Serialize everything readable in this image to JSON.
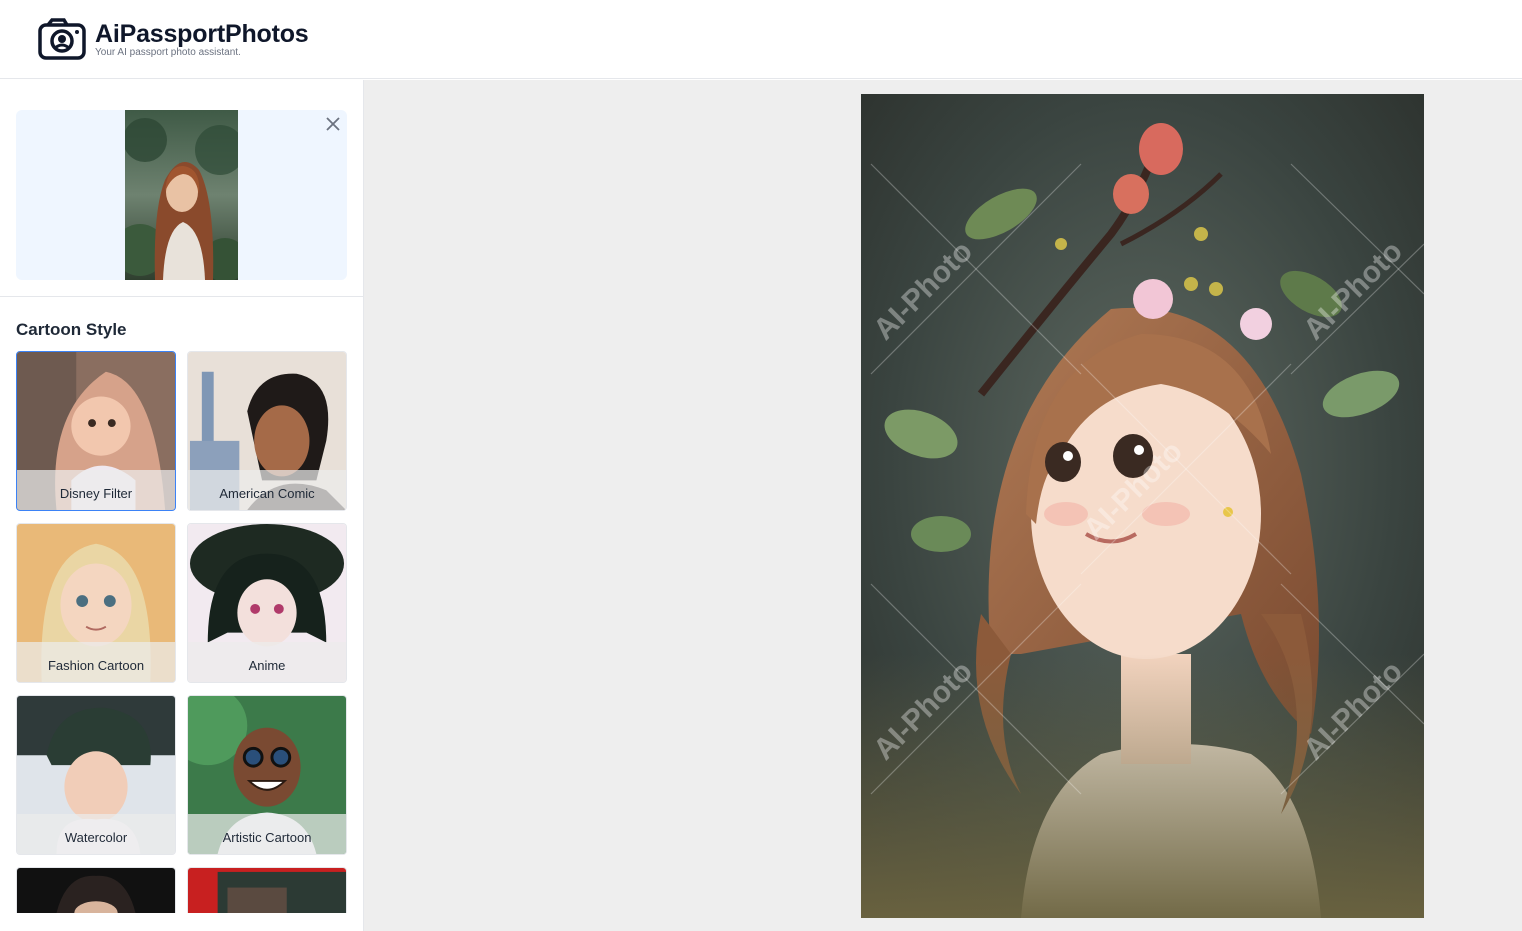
{
  "header": {
    "brand_title": "AiPassportPhotos",
    "brand_subtitle": "Your AI passport photo assistant.",
    "logo_icon": "camera-icon"
  },
  "sidebar": {
    "upload": {
      "close_icon": "close-icon"
    },
    "section_title": "Cartoon Style",
    "styles": [
      {
        "label": "Disney Filter",
        "selected": true
      },
      {
        "label": "American Comic",
        "selected": false
      },
      {
        "label": "Fashion Cartoon",
        "selected": false
      },
      {
        "label": "Anime",
        "selected": false
      },
      {
        "label": "Watercolor",
        "selected": false
      },
      {
        "label": "Artistic Cartoon",
        "selected": false
      }
    ]
  },
  "main": {
    "watermark_text": "AI-Photo"
  },
  "colors": {
    "accent": "#3b82f6",
    "upload_bg": "#eff6ff",
    "canvas_bg": "#eeeeee"
  }
}
